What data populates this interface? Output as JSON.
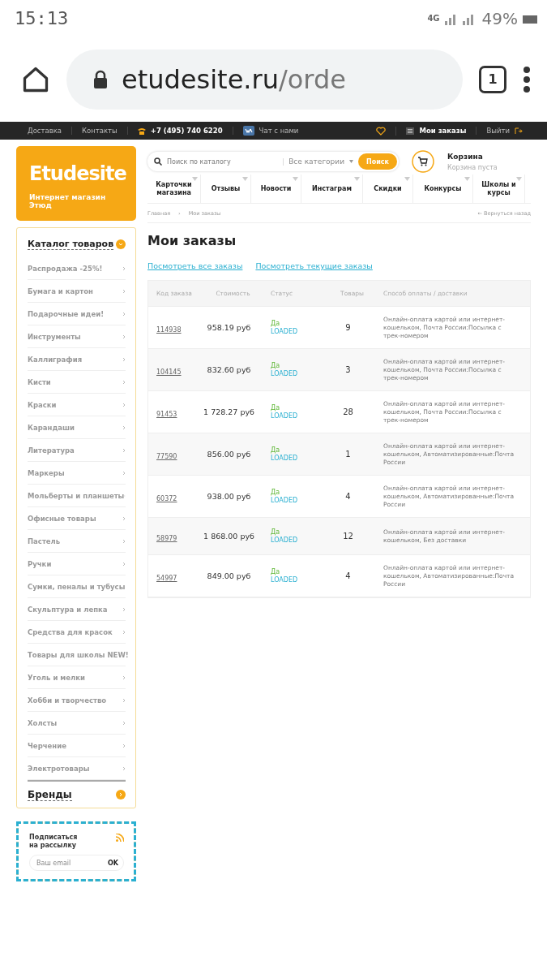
{
  "phone_status": {
    "time": "15:13",
    "network": "4G",
    "battery": "49%"
  },
  "browser": {
    "url_host": "etudesite.ru",
    "url_path": "/orde",
    "tab_count": "1"
  },
  "top_bar": {
    "links": [
      "Доставка",
      "Контакты"
    ],
    "phone": "+7 (495) 740 6220",
    "chat": "Чат с нами",
    "orders": "Мои заказы",
    "logout": "Выйти"
  },
  "logo": {
    "name": "Etudesite",
    "tagline": "Интернет магазин Этюд"
  },
  "search": {
    "placeholder": "Поиск по каталогу",
    "category": "Все категории",
    "button": "Поиск"
  },
  "cart": {
    "title": "Корзина",
    "subtitle": "Корзина пуста"
  },
  "nav": [
    "Карточки магазина",
    "Отзывы",
    "Новости",
    "Инстаграм",
    "Скидки",
    "Конкурсы",
    "Школы и курсы"
  ],
  "breadcrumbs": [
    "Главная",
    "Мои заказы"
  ],
  "breadcrumb_separator": "›",
  "back_link": "← Вернуться назад",
  "page_title": "Мои заказы",
  "filter_links": [
    "Посмотреть все заказы",
    "Посмотреть текущие заказы"
  ],
  "table": {
    "columns": [
      "Код заказа",
      "Стоимость",
      "Статус",
      "Товары",
      "Способ оплаты / доставки"
    ],
    "rows": [
      {
        "code": "114938",
        "cost": "958.19 руб",
        "paid": "Да",
        "status": "LOADED",
        "items": "9",
        "method": "Онлайн-оплата картой или интернет-кошельком, Почта России:Посылка с трек-номером"
      },
      {
        "code": "104145",
        "cost": "832.60 руб",
        "paid": "Да",
        "status": "LOADED",
        "items": "3",
        "method": "Онлайн-оплата картой или интернет-кошельком, Почта России:Посылка с трек-номером"
      },
      {
        "code": "91453",
        "cost": "1 728.27 руб",
        "paid": "Да",
        "status": "LOADED",
        "items": "28",
        "method": "Онлайн-оплата картой или интернет-кошельком, Почта России:Посылка с трек-номером"
      },
      {
        "code": "77590",
        "cost": "856.00 руб",
        "paid": "Да",
        "status": "LOADED",
        "items": "1",
        "method": "Онлайн-оплата картой или интернет-кошельком, Автоматизированные:Почта России"
      },
      {
        "code": "60372",
        "cost": "938.00 руб",
        "paid": "Да",
        "status": "LOADED",
        "items": "4",
        "method": "Онлайн-оплата картой или интернет-кошельком, Автоматизированные:Почта России"
      },
      {
        "code": "58979",
        "cost": "1 868.00 руб",
        "paid": "Да",
        "status": "LOADED",
        "items": "12",
        "method": "Онлайн-оплата картой или интернет-кошельком, Без доставки"
      },
      {
        "code": "54997",
        "cost": "849.00 руб",
        "paid": "Да",
        "status": "LOADED",
        "items": "4",
        "method": "Онлайн-оплата картой или интернет-кошельком, Автоматизированные:Почта России"
      }
    ]
  },
  "sidebar": {
    "catalog_title": "Каталог товаров",
    "items": [
      "Распродажа -25%!",
      "Бумага и картон",
      "Подарочные идеи!",
      "Инструменты",
      "Каллиграфия",
      "Кисти",
      "Краски",
      "Карандаши",
      "Литература",
      "Маркеры",
      "Мольберты и планшеты",
      "Офисные товары",
      "Пастель",
      "Ручки",
      "Сумки, пеналы и тубусы",
      "Скульптура и лепка",
      "Средства для красок",
      "Товары для школы NEW!",
      "Уголь и мелки",
      "Хобби и творчество",
      "Холсты",
      "Черчение",
      "Электротовары"
    ],
    "brands": "Бренды"
  },
  "subscribe": {
    "title": [
      "Подписаться",
      "на рассылку"
    ],
    "placeholder": "Ваш email",
    "button": "OK"
  }
}
